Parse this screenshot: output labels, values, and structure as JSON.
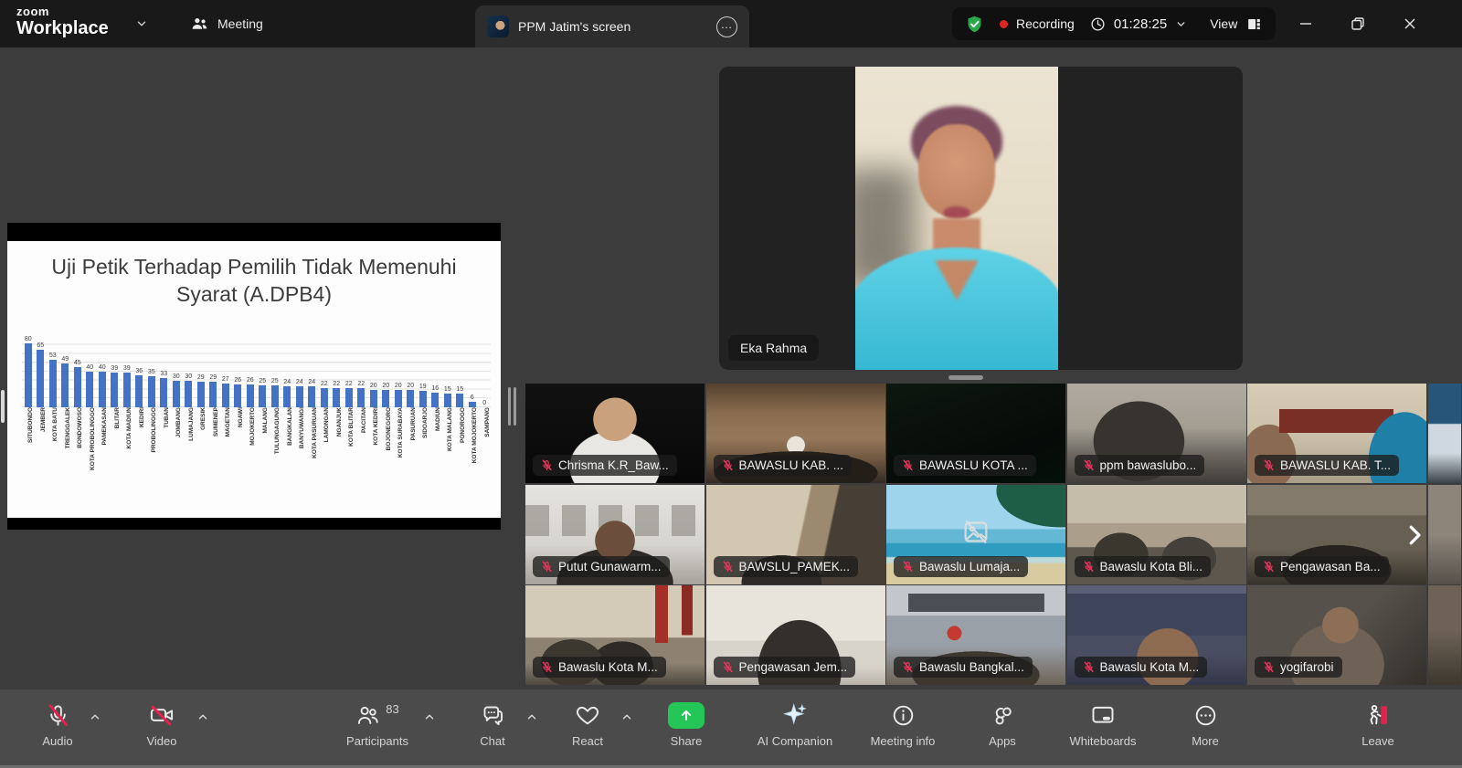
{
  "top_bar": {
    "logo_top": "zoom",
    "logo_bottom": "Workplace",
    "meeting_tab": "Meeting",
    "screen_share_tab": "PPM Jatim's screen",
    "recording_label": "Recording",
    "timer": "01:28:25",
    "view_label": "View"
  },
  "shared_screen": {
    "chart_data": {
      "type": "bar",
      "title": "Uji Petik Terhadap Pemilih Tidak Memenuhi Syarat (A.DPB4)",
      "categories": [
        "SITUBONDO",
        "JEMBER",
        "KOTA BATU",
        "TRENGGALEK",
        "BONDOWOSO",
        "KOTA PROBOLINGGO",
        "PAMEKASAN",
        "BLITAR",
        "KOTA MADIUN",
        "KEDIRI",
        "PROBOLINGGO",
        "TUBAN",
        "JOMBANG",
        "LUMAJANG",
        "GRESIK",
        "SUMENEP",
        "MAGETAN",
        "NGAWI",
        "MOJOKERTO",
        "MALANG",
        "TULUNGAGUNG",
        "BANGKALAN",
        "BANYUWANGI",
        "KOTA PASURUAN",
        "LAMONGAN",
        "NGANJUK",
        "KOTA BLITAR",
        "PACITAN",
        "KOTA KEDIRI",
        "BOJONEGORO",
        "KOTA SURABAYA",
        "PASURUAN",
        "SIDOARJO",
        "MADIUN",
        "KOTA MALANG",
        "PONOROGO",
        "KOTA MOJOKERTO",
        "SAMPANG"
      ],
      "values": [
        80,
        65,
        53,
        49,
        45,
        40,
        40,
        39,
        39,
        36,
        35,
        33,
        30,
        30,
        29,
        29,
        27,
        26,
        26,
        25,
        25,
        24,
        24,
        24,
        22,
        22,
        22,
        22,
        20,
        20,
        20,
        20,
        19,
        16,
        15,
        15,
        6,
        0
      ],
      "xlabel": "",
      "ylabel": "",
      "ylim": [
        0,
        80
      ],
      "grid": true,
      "legend": "none",
      "bar_color": "#4472c4"
    }
  },
  "speaker": {
    "name": "Eka Rahma"
  },
  "gallery": {
    "participants": [
      "Chrisma K.R_Baw...",
      "BAWASLU KAB. ...",
      "BAWASLU KOTA ...",
      "ppm bawaslubo...",
      "BAWASLU KAB. T...",
      "Putut Gunawarm...",
      "BAWSLU_PAMEK...",
      "Bawaslu Lumaja...",
      "Bawaslu Kota Bli...",
      "Pengawasan Ba...",
      "Bawaslu Kota M...",
      "Pengawasan Jem...",
      "Bawaslu Bangkal...",
      "Bawaslu Kota M...",
      "yogifarobi"
    ]
  },
  "toolbar": {
    "audio": "Audio",
    "video": "Video",
    "participants": "Participants",
    "participants_count": "83",
    "chat": "Chat",
    "react": "React",
    "share": "Share",
    "ai_companion": "AI Companion",
    "meeting_info": "Meeting info",
    "apps": "Apps",
    "whiteboards": "Whiteboards",
    "more": "More",
    "leave": "Leave"
  },
  "colors": {
    "accent_green": "#24c658",
    "record_red": "#e02525",
    "danger_pink": "#e5214e",
    "bar_blue": "#4472c4",
    "shield_green": "#2ba84a"
  }
}
